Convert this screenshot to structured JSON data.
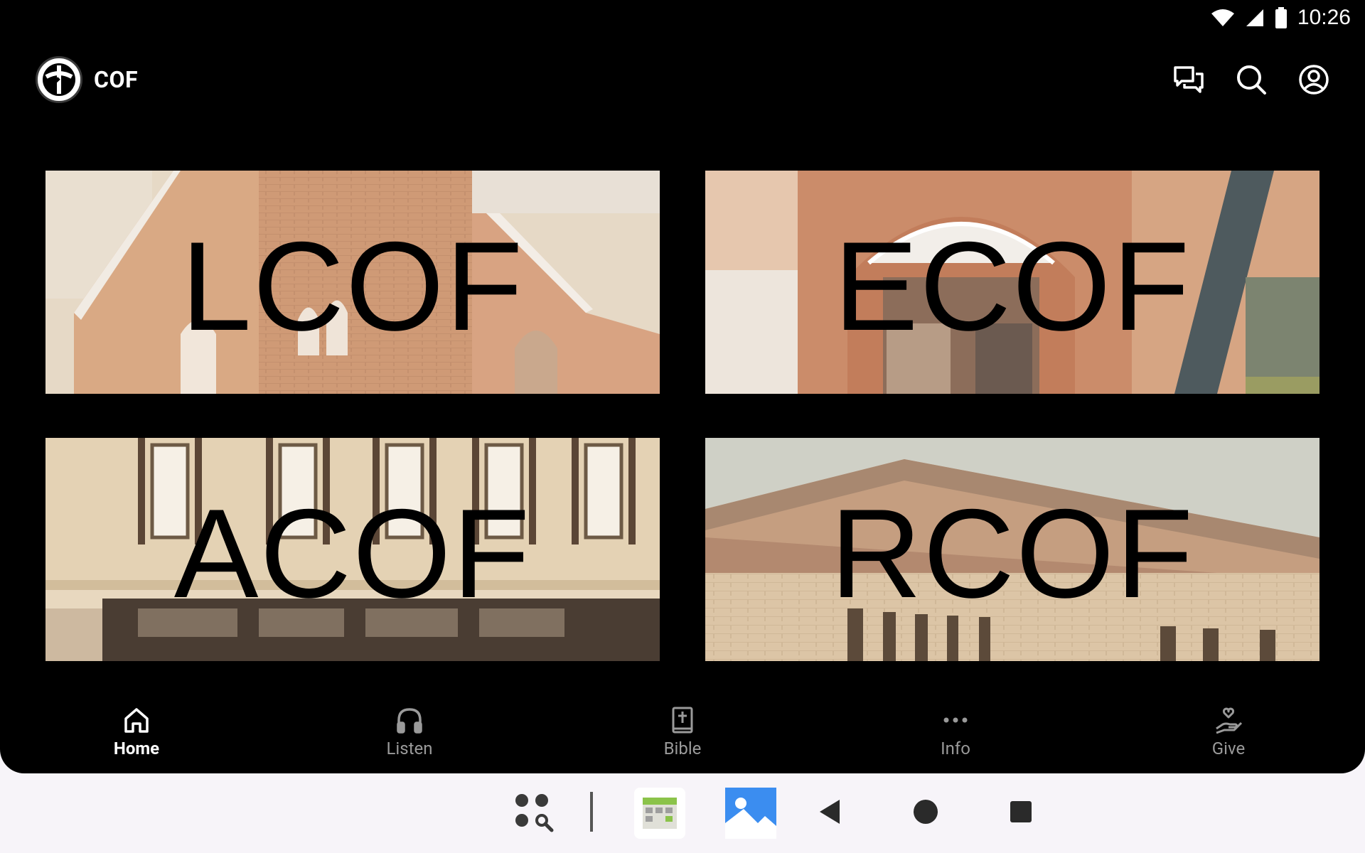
{
  "status_bar": {
    "time": "10:26",
    "icons": [
      "wifi-icon",
      "cell-signal-icon",
      "battery-icon"
    ]
  },
  "header": {
    "logo": "church-logo-icon",
    "title": "COF",
    "actions": [
      {
        "name": "chat-icon"
      },
      {
        "name": "search-icon"
      },
      {
        "name": "account-icon"
      }
    ]
  },
  "locations": [
    {
      "label": "LCOF",
      "image": "brick-church-with-steeple"
    },
    {
      "label": "ECOF",
      "image": "brick-arched-entrance-with-welcome-banner"
    },
    {
      "label": "ACOF",
      "image": "historic-storefront-building"
    },
    {
      "label": "RCOF",
      "image": "modern-brick-building"
    }
  ],
  "bottom_nav": {
    "items": [
      {
        "label": "Home",
        "icon": "home-icon",
        "active": true
      },
      {
        "label": "Listen",
        "icon": "headphones-icon",
        "active": false
      },
      {
        "label": "Bible",
        "icon": "bible-icon",
        "active": false
      },
      {
        "label": "Info",
        "icon": "more-horizontal-icon",
        "active": false
      },
      {
        "label": "Give",
        "icon": "give-heart-hand-icon",
        "active": false
      }
    ]
  },
  "system_nav": {
    "items": [
      "app-drawer-search-icon",
      "calendar-app-icon",
      "gallery-app-icon",
      "back-icon",
      "home-circle-icon",
      "recents-icon"
    ]
  },
  "colors": {
    "background": "#000000",
    "active_nav": "#ffffff",
    "inactive_nav": "#9a9a9a",
    "system_bar": "#f7f4f9"
  }
}
